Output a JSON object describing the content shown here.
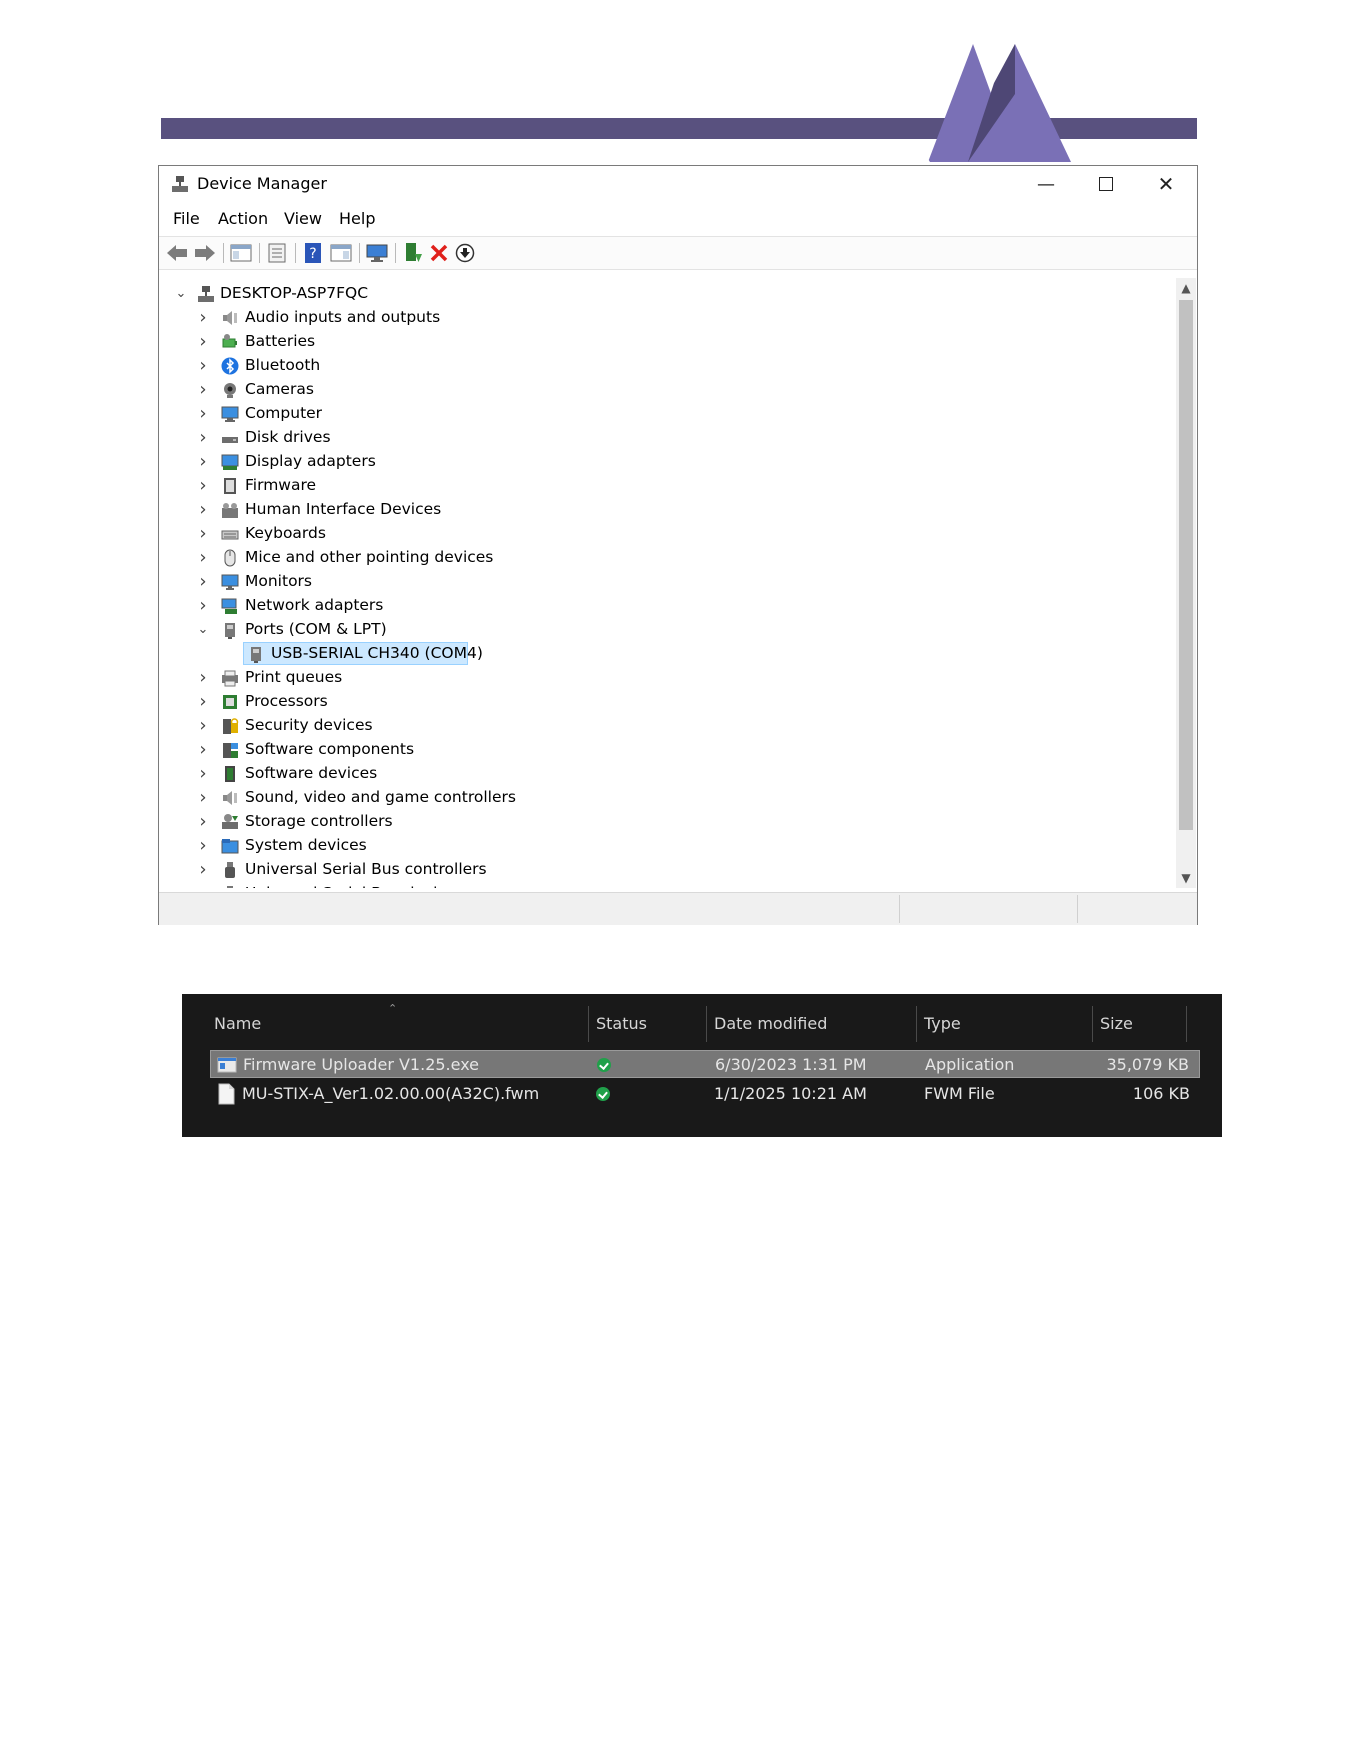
{
  "device_manager": {
    "title": "Device Manager",
    "menu": [
      "File",
      "Action",
      "View",
      "Help"
    ],
    "toolbar_icons": [
      "back-arrow-icon",
      "forward-arrow-icon",
      "show-hide-tree-icon",
      "properties-icon",
      "help-icon",
      "action-pane-icon",
      "scan-hardware-icon",
      "update-driver-icon",
      "uninstall-icon",
      "disable-device-icon"
    ],
    "tree": {
      "root": "DESKTOP-ASP7FQC",
      "categories": [
        {
          "label": "Audio inputs and outputs",
          "icon": "speaker-icon",
          "expanded": false
        },
        {
          "label": "Batteries",
          "icon": "battery-icon",
          "expanded": false
        },
        {
          "label": "Bluetooth",
          "icon": "bluetooth-icon",
          "expanded": false
        },
        {
          "label": "Cameras",
          "icon": "camera-icon",
          "expanded": false
        },
        {
          "label": "Computer",
          "icon": "computer-icon",
          "expanded": false
        },
        {
          "label": "Disk drives",
          "icon": "disk-drive-icon",
          "expanded": false
        },
        {
          "label": "Display adapters",
          "icon": "display-adapter-icon",
          "expanded": false
        },
        {
          "label": "Firmware",
          "icon": "firmware-icon",
          "expanded": false
        },
        {
          "label": "Human Interface Devices",
          "icon": "hid-icon",
          "expanded": false
        },
        {
          "label": "Keyboards",
          "icon": "keyboard-icon",
          "expanded": false
        },
        {
          "label": "Mice and other pointing devices",
          "icon": "mouse-icon",
          "expanded": false
        },
        {
          "label": "Monitors",
          "icon": "monitor-icon",
          "expanded": false
        },
        {
          "label": "Network adapters",
          "icon": "network-adapter-icon",
          "expanded": false
        },
        {
          "label": "Ports (COM & LPT)",
          "icon": "port-icon",
          "expanded": true,
          "children": [
            "USB-SERIAL CH340 (COM4)"
          ]
        },
        {
          "label": "Print queues",
          "icon": "printer-icon",
          "expanded": false
        },
        {
          "label": "Processors",
          "icon": "processor-icon",
          "expanded": false
        },
        {
          "label": "Security devices",
          "icon": "security-device-icon",
          "expanded": false
        },
        {
          "label": "Software components",
          "icon": "software-component-icon",
          "expanded": false
        },
        {
          "label": "Software devices",
          "icon": "software-device-icon",
          "expanded": false
        },
        {
          "label": "Sound, video and game controllers",
          "icon": "speaker-icon",
          "expanded": false
        },
        {
          "label": "Storage controllers",
          "icon": "storage-controller-icon",
          "expanded": false
        },
        {
          "label": "System devices",
          "icon": "system-devices-icon",
          "expanded": false
        },
        {
          "label": "Universal Serial Bus controllers",
          "icon": "usb-icon",
          "expanded": false
        },
        {
          "label": "Universal Serial Bus devices",
          "icon": "usb-icon",
          "expanded": false
        }
      ]
    }
  },
  "explorer": {
    "columns": {
      "name": "Name",
      "status": "Status",
      "date": "Date modified",
      "type": "Type",
      "size": "Size"
    },
    "files": [
      {
        "name": "Firmware Uploader V1.25.exe",
        "date": "6/30/2023 1:31 PM",
        "type": "Application",
        "size": "35,079 KB",
        "icon": "application-icon",
        "selected": true
      },
      {
        "name": "MU-STIX-A_Ver1.02.00.00(A32C).fwm",
        "date": "1/1/2025 10:21 AM",
        "type": "FWM File",
        "size": "106 KB",
        "icon": "file-icon",
        "selected": false
      }
    ]
  },
  "colors": {
    "header_band": "#59517f",
    "logo_light": "#7a70b6",
    "logo_dark": "#4e4775",
    "selection": "#cce8ff",
    "explorer_bg": "#191919",
    "status_ok": "#20a04a"
  }
}
